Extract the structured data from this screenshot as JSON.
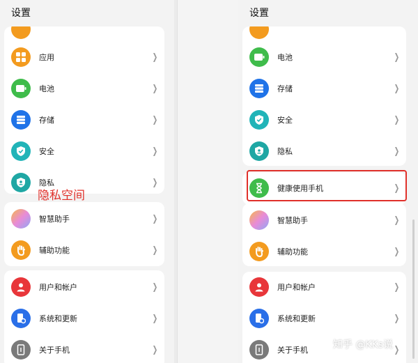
{
  "left": {
    "title": "设置",
    "group1": [
      "应用",
      "电池",
      "存储",
      "安全",
      "隐私"
    ],
    "group2": [
      "智慧助手",
      "辅助功能"
    ],
    "group3": [
      "用户和帐户",
      "系统和更新",
      "关于手机"
    ]
  },
  "right": {
    "title": "设置",
    "group1": [
      "电池",
      "存储",
      "安全",
      "隐私"
    ],
    "group2": [
      "健康使用手机"
    ],
    "group3": [
      "智慧助手",
      "辅助功能"
    ],
    "group4": [
      "用户和帐户",
      "系统和更新",
      "关于手机"
    ]
  },
  "annotation": {
    "text": "隐私空间"
  },
  "watermark": "知乎 @KKs说",
  "colors": {
    "apps": "#f39b1f",
    "battery": "#3fbc4b",
    "storage": "#1f73e8",
    "security": "#21b4b8",
    "privacy": "#1fa7a4",
    "assistant": "#c98ee6",
    "accessibility": "#f39b1f",
    "users": "#e8363a",
    "system": "#2a6fe8",
    "about": "#7a7a7a",
    "health": "#3fbc4b",
    "highlight": "#e0302a"
  }
}
